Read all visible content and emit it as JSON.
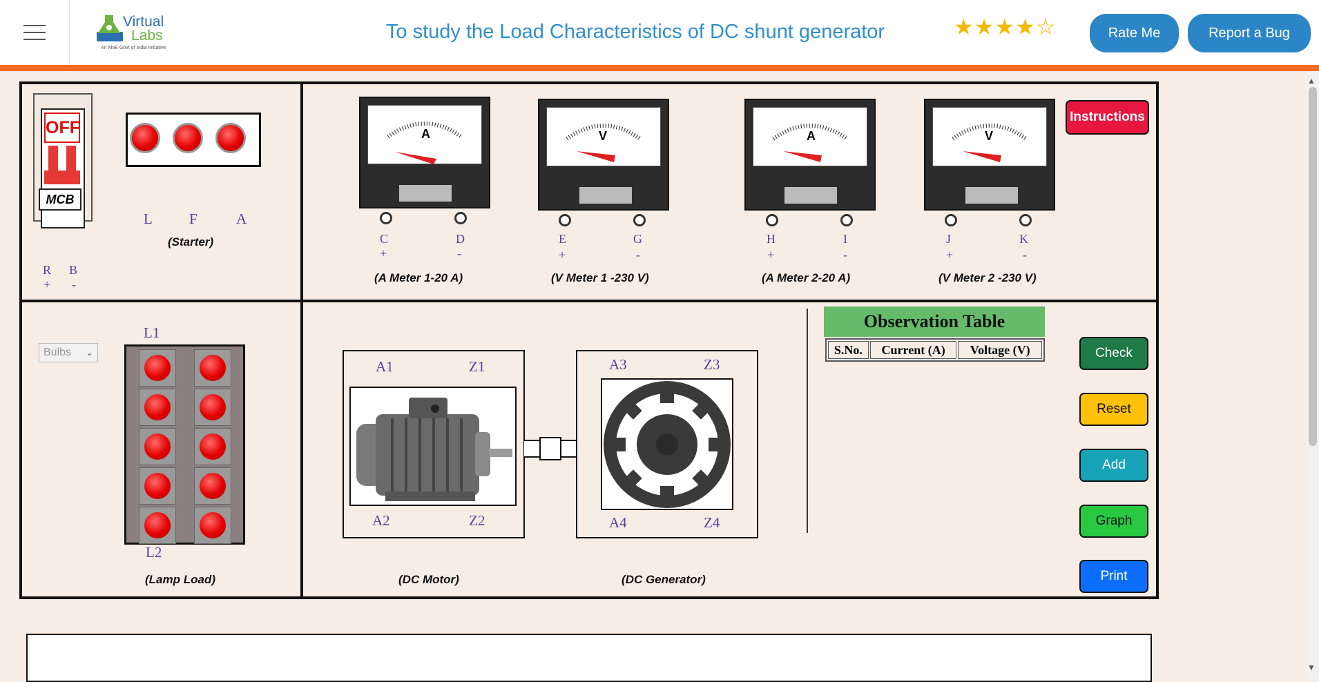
{
  "header": {
    "menu_icon": "hamburger-icon",
    "logo": {
      "line1": "Virtual",
      "line2": "Labs",
      "tagline": "An MoE Govt of India Initiative"
    },
    "title": "To study the Load Characteristics of DC shunt generator",
    "rating": {
      "filled": 4,
      "total": 5,
      "filled_glyphs": "★★★★",
      "empty_glyphs": "☆"
    },
    "rate_label": "Rate Me",
    "bug_label": "Report a Bug"
  },
  "mcb": {
    "state": "OFF",
    "label": "MCB"
  },
  "starter": {
    "terminals": [
      "L",
      "F",
      "A"
    ],
    "label": "(Starter)"
  },
  "supply": {
    "terminals": [
      "R",
      "B"
    ],
    "signs": [
      "+",
      "-"
    ]
  },
  "meters": [
    {
      "symbol": "A",
      "terminals": [
        "C",
        "D"
      ],
      "signs": [
        "+",
        "-"
      ],
      "label": "(A Meter 1-20 A)"
    },
    {
      "symbol": "V",
      "terminals": [
        "E",
        "G"
      ],
      "signs": [
        "+",
        "-"
      ],
      "label": "(V Meter 1 -230 V)"
    },
    {
      "symbol": "A",
      "terminals": [
        "H",
        "I"
      ],
      "signs": [
        "+",
        "-"
      ],
      "label": "(A Meter 2-20 A)"
    },
    {
      "symbol": "V",
      "terminals": [
        "J",
        "K"
      ],
      "signs": [
        "+",
        "-"
      ],
      "label": "(V Meter 2 -230 V)"
    }
  ],
  "instructions_label": "Instructions",
  "lamp_load": {
    "select_value": "Bulbs",
    "top_terminal": "L1",
    "bottom_terminal": "L2",
    "label": "(Lamp Load)"
  },
  "motor": {
    "terminals": [
      "A1",
      "Z1",
      "A2",
      "Z2"
    ],
    "label": "(DC Motor)"
  },
  "generator": {
    "terminals": [
      "A3",
      "Z3",
      "A4",
      "Z4"
    ],
    "label": "(DC Generator)"
  },
  "observation": {
    "title": "Observation Table",
    "columns": [
      "S.No.",
      "Current (A)",
      "Voltage (V)"
    ]
  },
  "buttons": {
    "check": {
      "label": "Check",
      "color": "#1e7a46"
    },
    "reset": {
      "label": "Reset",
      "color": "#ffc107"
    },
    "add": {
      "label": "Add",
      "color": "#17a2b8"
    },
    "graph": {
      "label": "Graph",
      "color": "#28c940"
    },
    "print": {
      "label": "Print",
      "color": "#0d6efd"
    }
  },
  "colors": {
    "accent_orange": "#f26b21",
    "title_blue": "#2e8fcb",
    "terminal_purple": "#5a3d9e",
    "instructions_red": "#e8173f"
  }
}
